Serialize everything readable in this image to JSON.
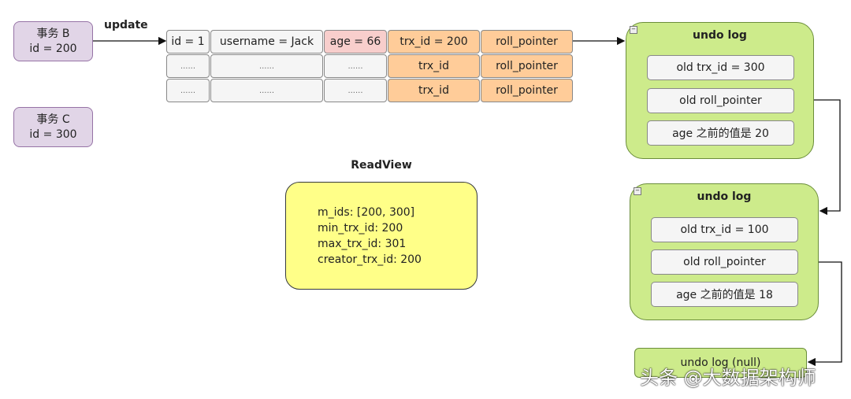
{
  "transactions": [
    {
      "name": "事务 B",
      "id": "id = 200"
    },
    {
      "name": "事务 C",
      "id": "id = 300"
    }
  ],
  "update_label": "update",
  "table": {
    "rows": [
      [
        "id = 1",
        "username = Jack",
        "age = 66",
        "trx_id = 200",
        "roll_pointer"
      ],
      [
        "......",
        "......",
        "......",
        "trx_id",
        "roll_pointer"
      ],
      [
        "......",
        "......",
        "......",
        "trx_id",
        "roll_pointer"
      ]
    ]
  },
  "undo_logs": [
    {
      "title": "undo log",
      "items": [
        "old trx_id = 300",
        "old roll_pointer",
        "age 之前的值是 20"
      ]
    },
    {
      "title": "undo log",
      "items": [
        "old trx_id = 100",
        "old roll_pointer",
        "age 之前的值是 18"
      ]
    }
  ],
  "undo_null": "undo log (null)",
  "readview": {
    "title": "ReadView",
    "lines": [
      "m_ids: [200, 300]",
      "min_trx_id: 200",
      "max_trx_id: 301",
      "creator_trx_id: 200"
    ]
  },
  "watermark": "头条 @大数据架构师",
  "colors": {
    "transaction": "#e1d5e7",
    "age_cell": "#f8cecc",
    "trx_cell": "#ffcc99",
    "undo_log": "#cdeb8b",
    "readview": "#ffff88"
  }
}
